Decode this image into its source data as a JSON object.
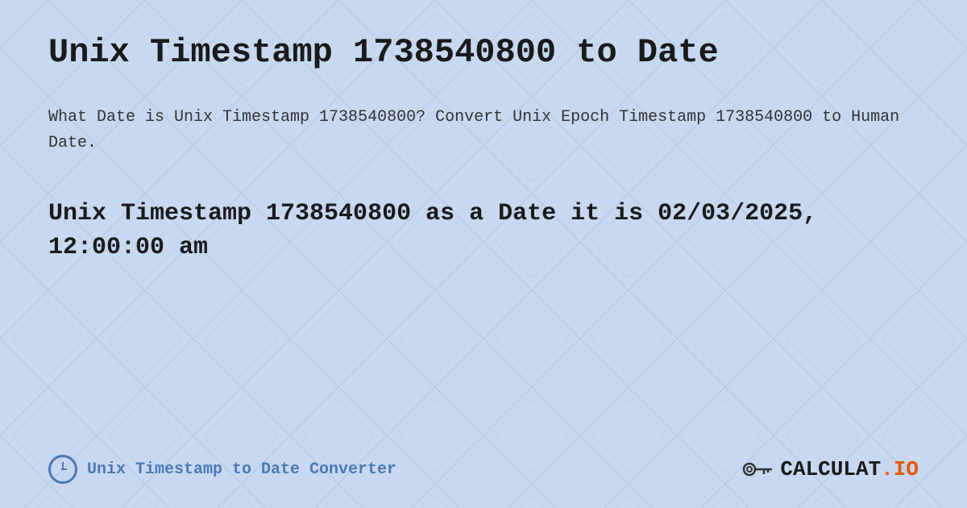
{
  "background": {
    "color": "#c8d8f0"
  },
  "header": {
    "title": "Unix Timestamp 1738540800 to Date"
  },
  "description": {
    "text": "What Date is Unix Timestamp 1738540800? Convert Unix Epoch Timestamp 1738540800 to Human Date."
  },
  "result": {
    "text": "Unix Timestamp 1738540800 as a Date it is 02/03/2025, 12:00:00 am"
  },
  "footer": {
    "label": "Unix Timestamp to Date Converter",
    "logo_text_main": "CALCULAT",
    "logo_text_highlight": ".IO"
  }
}
